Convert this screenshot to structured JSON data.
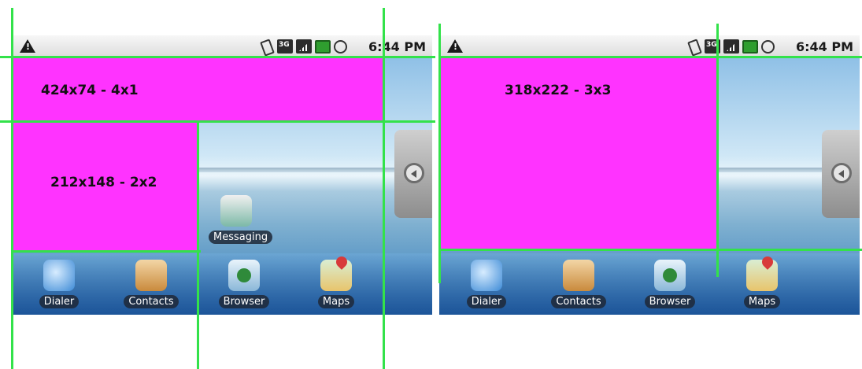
{
  "left_screen": {
    "status": {
      "time": "6:44 PM",
      "icons": [
        "warning-icon",
        "vibrate-icon",
        "3g-icon",
        "signal-icon",
        "battery-icon",
        "alarm-icon"
      ]
    },
    "widgets": [
      {
        "label": "424x74 - 4x1"
      },
      {
        "label": "212x148 - 2x2"
      }
    ],
    "messaging_label": "Messaging",
    "dock": [
      {
        "label": "Dialer"
      },
      {
        "label": "Contacts"
      },
      {
        "label": "Browser"
      },
      {
        "label": "Maps"
      }
    ]
  },
  "right_screen": {
    "status": {
      "time": "6:44 PM",
      "icons": [
        "warning-icon",
        "vibrate-icon",
        "3g-icon",
        "signal-icon",
        "battery-icon",
        "alarm-icon"
      ]
    },
    "widgets": [
      {
        "label": "318x222 - 3x3"
      }
    ],
    "dock": [
      {
        "label": "Dialer"
      },
      {
        "label": "Contacts"
      },
      {
        "label": "Browser"
      },
      {
        "label": "Maps"
      }
    ]
  },
  "colors": {
    "widget": "#ff33ff",
    "grid_line": "#33e24a"
  }
}
